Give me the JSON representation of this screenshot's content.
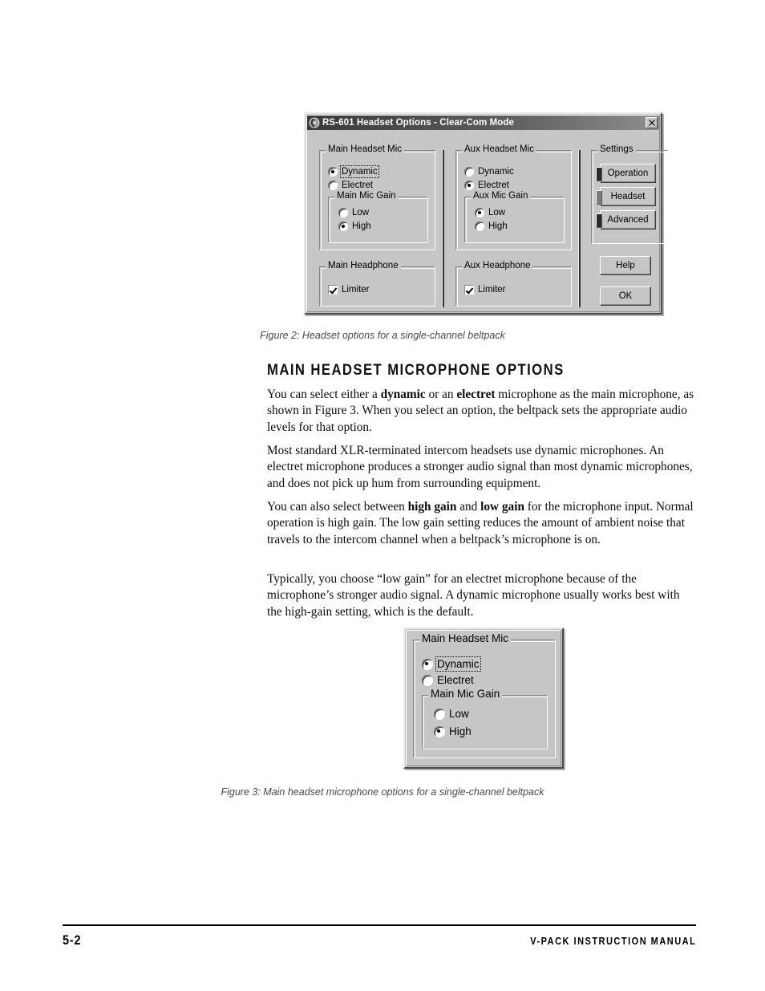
{
  "page": {
    "number": "5-2",
    "manual_title": "V-PACK INSTRUCTION MANUAL"
  },
  "figure2": {
    "caption": "Figure 2: Headset options for a single-channel beltpack",
    "dialog": {
      "title": "RS-601 Headset Options - Clear-Com Mode",
      "close_label": "✕",
      "groups": {
        "main_headset_mic": {
          "title": "Main Headset Mic",
          "options": [
            {
              "label": "Dynamic",
              "checked": true,
              "focused": true
            },
            {
              "label": "Electret",
              "checked": false,
              "focused": false
            }
          ],
          "gain": {
            "title": "Main Mic Gain",
            "options": [
              {
                "label": "Low",
                "checked": false
              },
              {
                "label": "High",
                "checked": true
              }
            ]
          }
        },
        "aux_headset_mic": {
          "title": "Aux Headset Mic",
          "options": [
            {
              "label": "Dynamic",
              "checked": false,
              "focused": false
            },
            {
              "label": "Electret",
              "checked": true,
              "focused": false
            }
          ],
          "gain": {
            "title": "Aux Mic Gain",
            "options": [
              {
                "label": "Low",
                "checked": true
              },
              {
                "label": "High",
                "checked": false
              }
            ]
          }
        },
        "main_headphone": {
          "title": "Main Headphone",
          "limiter": {
            "label": "Limiter",
            "checked": true
          }
        },
        "aux_headphone": {
          "title": "Aux Headphone",
          "limiter": {
            "label": "Limiter",
            "checked": true
          }
        },
        "settings": {
          "title": "Settings",
          "buttons": [
            {
              "label": "Operation",
              "indicator": "dark"
            },
            {
              "label": "Headset",
              "indicator": "dim"
            },
            {
              "label": "Advanced",
              "indicator": "dark"
            }
          ]
        }
      },
      "help_label": "Help",
      "ok_label": "OK"
    }
  },
  "heading": "MAIN HEADSET MICROPHONE OPTIONS",
  "paragraphs": {
    "p1_a": "You can select either a ",
    "p1_b1": "dynamic",
    "p1_c": " or an ",
    "p1_b2": "electret",
    "p1_d": " microphone as the main microphone, as shown in Figure 3. When you select an option, the beltpack sets the appropriate audio levels for that option.",
    "p2": "Most standard XLR-terminated intercom headsets use dynamic microphones. An electret microphone produces a stronger audio signal than most dynamic microphones, and does not pick up hum from surrounding equipment.",
    "p3_a": "You can also select between ",
    "p3_b1": "high gain",
    "p3_c": " and ",
    "p3_b2": "low gain",
    "p3_d": " for the microphone input. Normal operation is high gain. The low gain setting reduces the amount of ambient noise that travels to the intercom channel when a beltpack’s microphone is on.",
    "p4": "Typically, you choose “low gain” for an electret microphone because of the microphone’s stronger audio signal. A dynamic microphone usually works best with the high-gain setting, which is the default."
  },
  "figure3": {
    "caption": "Figure 3: Main headset microphone options for a single-channel beltpack",
    "dialog": {
      "group_title": "Main Headset Mic",
      "options": [
        {
          "label": "Dynamic",
          "checked": true,
          "focused": true
        },
        {
          "label": "Electret",
          "checked": false,
          "focused": false
        }
      ],
      "gain": {
        "title": "Main Mic Gain",
        "options": [
          {
            "label": "Low",
            "checked": false
          },
          {
            "label": "High",
            "checked": true
          }
        ]
      }
    }
  },
  "colors": {
    "dialog_face": "#c6c6c6",
    "titlebar_dark": "#3a3a3a",
    "caption_gray": "#4a4a4a"
  }
}
